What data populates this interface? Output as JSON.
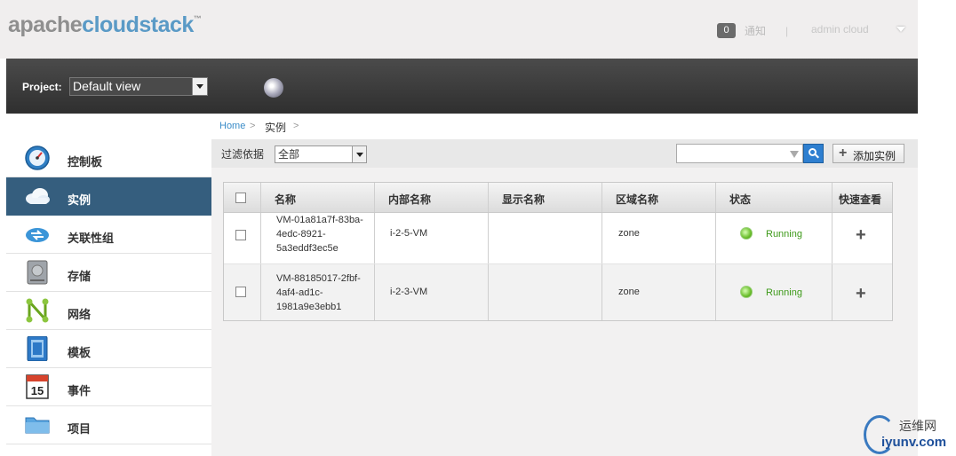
{
  "header": {
    "logo_prefix": "apache",
    "logo_brand": "cloudstack",
    "logo_tm": "™",
    "notification_count": "0",
    "notification_label": "通知",
    "separator": "|",
    "user_label": "admin cloud"
  },
  "project_bar": {
    "label": "Project:",
    "selected": "Default view"
  },
  "sidebar": {
    "items": [
      {
        "label": "控制板",
        "icon": "dashboard-icon"
      },
      {
        "label": "实例",
        "icon": "cloud-icon",
        "active": true
      },
      {
        "label": "关联性组",
        "icon": "affinity-groups-icon"
      },
      {
        "label": "存储",
        "icon": "storage-disk-icon"
      },
      {
        "label": "网络",
        "icon": "network-icon"
      },
      {
        "label": "模板",
        "icon": "template-icon"
      },
      {
        "label": "事件",
        "icon": "calendar-icon",
        "icon_text": "15"
      },
      {
        "label": "项目",
        "icon": "folder-icon"
      }
    ]
  },
  "breadcrumb": {
    "home": "Home",
    "sep": ">",
    "current": "实例"
  },
  "filter": {
    "label": "过滤依据",
    "selected": "全部",
    "add_button": "添加实例"
  },
  "table": {
    "headers": [
      "名称",
      "内部名称",
      "显示名称",
      "区域名称",
      "状态",
      "快速查看"
    ],
    "rows": [
      {
        "name": "VM-01a81a7f-83ba-4edc-8921-5a3eddf3ec5e",
        "internal": "i-2-5-VM",
        "display": "",
        "zone": "zone",
        "status": "Running"
      },
      {
        "name": "VM-88185017-2fbf-4af4-ad1c-1981a9e3ebb1",
        "internal": "i-2-3-VM",
        "display": "",
        "zone": "zone",
        "status": "Running"
      }
    ]
  },
  "watermark": {
    "cn": "运维网",
    "url": "iyunv.com"
  },
  "colors": {
    "accent": "#355e7e",
    "link": "#3a8cc8",
    "running": "#3e9a1a",
    "dark_bar": "#3a3a3a"
  }
}
